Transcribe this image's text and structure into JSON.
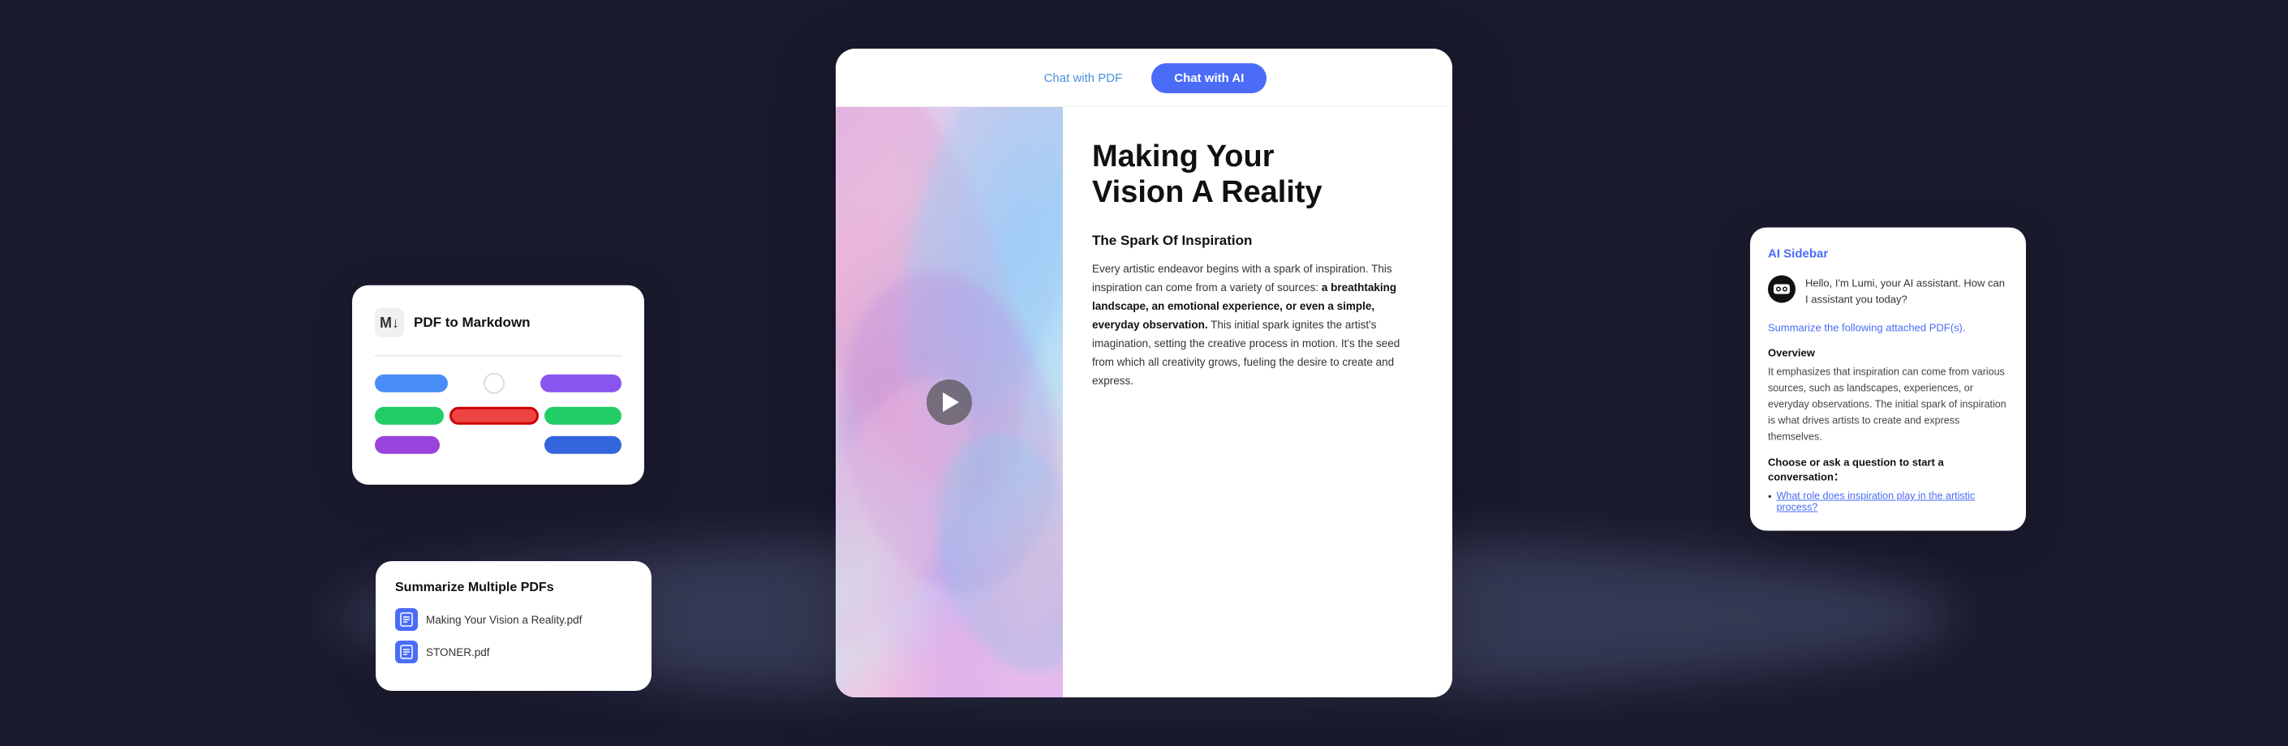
{
  "background": {
    "color": "#1a1a2e"
  },
  "tabs": {
    "chat_pdf": "Chat with PDF",
    "chat_ai": "Chat with AI"
  },
  "main_card": {
    "title": "Making Your\nVision A Reality",
    "section_title": "The Spark Of Inspiration",
    "body_text": "Every artistic endeavor begins with a spark of inspiration. This inspiration can come from a variety of sources:",
    "body_highlighted": "a breathtaking landscape, an emotional experience, or even a simple, everyday observation.",
    "body_continued": "This initial spark ignites the artist's imagination, setting the creative process in motion. It's the seed from which all creativity grows, fueling the desire to create and express."
  },
  "markdown_card": {
    "title": "PDF to Markdown",
    "icon_label": "M↓",
    "divider": true,
    "pills": [
      {
        "color": "blue",
        "size": "sm",
        "row": 0,
        "side": "left"
      },
      {
        "color": "purple",
        "size": "md",
        "row": 0,
        "side": "right"
      },
      {
        "color": "green",
        "size": "sm",
        "row": 1,
        "side": "left"
      },
      {
        "color": "red",
        "size": "lg",
        "row": 1,
        "side": "center"
      },
      {
        "color": "green",
        "size": "sm",
        "row": 1,
        "side": "right"
      },
      {
        "color": "purple",
        "size": "sm",
        "row": 2,
        "side": "left"
      },
      {
        "color": "blue",
        "size": "md",
        "row": 2,
        "side": "right"
      }
    ]
  },
  "summarize_card": {
    "title": "Summarize Multiple PDFs",
    "files": [
      {
        "name": "Making Your Vision a Reality.pdf"
      },
      {
        "name": "STONER.pdf"
      }
    ],
    "file_icon_label": "P"
  },
  "ai_sidebar": {
    "header": "AI Sidebar",
    "avatar_label": "AI",
    "greeting": "Hello, I'm Lumi, your AI assistant. How can I assistant you today?",
    "user_prompt": "Summarize the following attached PDF(s).",
    "overview_label": "Overview",
    "overview_text": "It emphasizes that inspiration can come from various sources, such as landscapes, experiences, or everyday observations. The initial spark of inspiration is what drives artists to create and express themselves.",
    "cta_label": "Choose or ask a question to start a conversation：",
    "suggestion_text": "What role does inspiration play in the artistic process?"
  },
  "play_button": {
    "label": "Play"
  }
}
